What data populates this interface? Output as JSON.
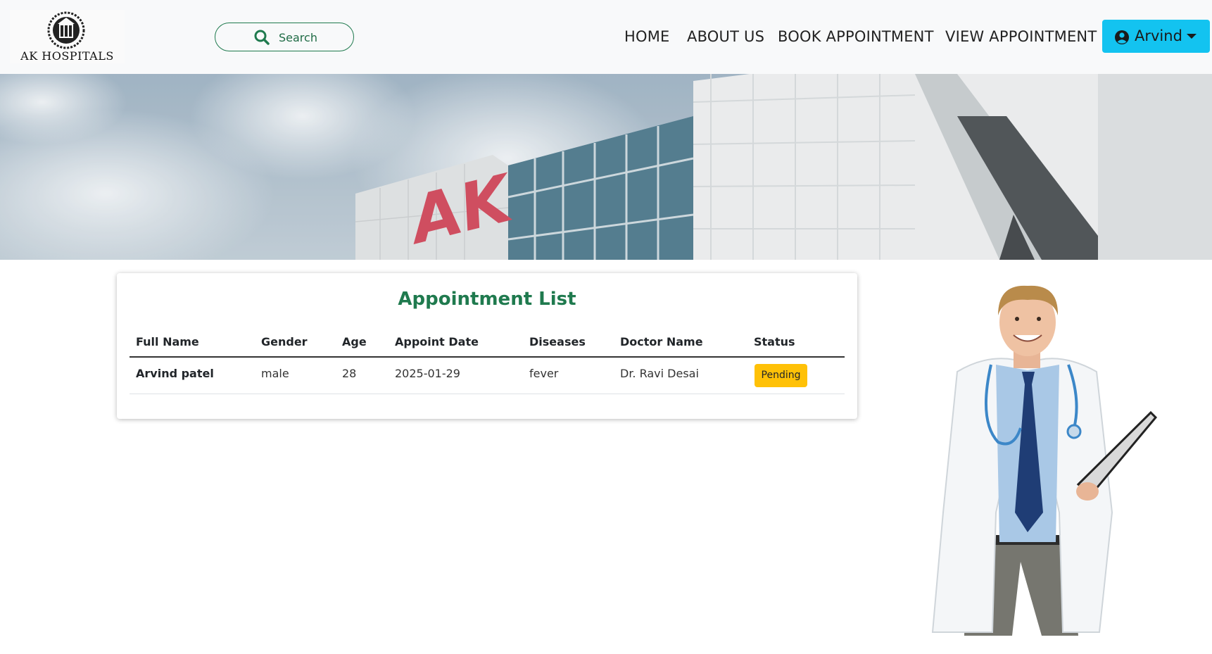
{
  "brand": {
    "name": "AK HOSPITALS"
  },
  "search": {
    "label": "Search"
  },
  "nav": {
    "links": [
      "HOME",
      "ABOUT US",
      "BOOK APPOINTMENT",
      "VIEW APPOINTMENT"
    ],
    "user_name": "Arvind"
  },
  "hero": {
    "sign_text": "AK"
  },
  "appointments": {
    "title": "Appointment List",
    "columns": [
      "Full Name",
      "Gender",
      "Age",
      "Appoint Date",
      "Diseases",
      "Doctor Name",
      "Status"
    ],
    "rows": [
      [
        "Arvind patel",
        "male",
        "28",
        "2025-01-29",
        "fever",
        "Dr. Ravi Desai",
        "Pending"
      ]
    ]
  },
  "colors": {
    "accent_green": "#1f7a4e",
    "user_button": "#13c3f0",
    "pending_badge": "#ffc107"
  },
  "icons": [
    "search-icon",
    "user-circle-icon",
    "chevron-down-icon"
  ]
}
